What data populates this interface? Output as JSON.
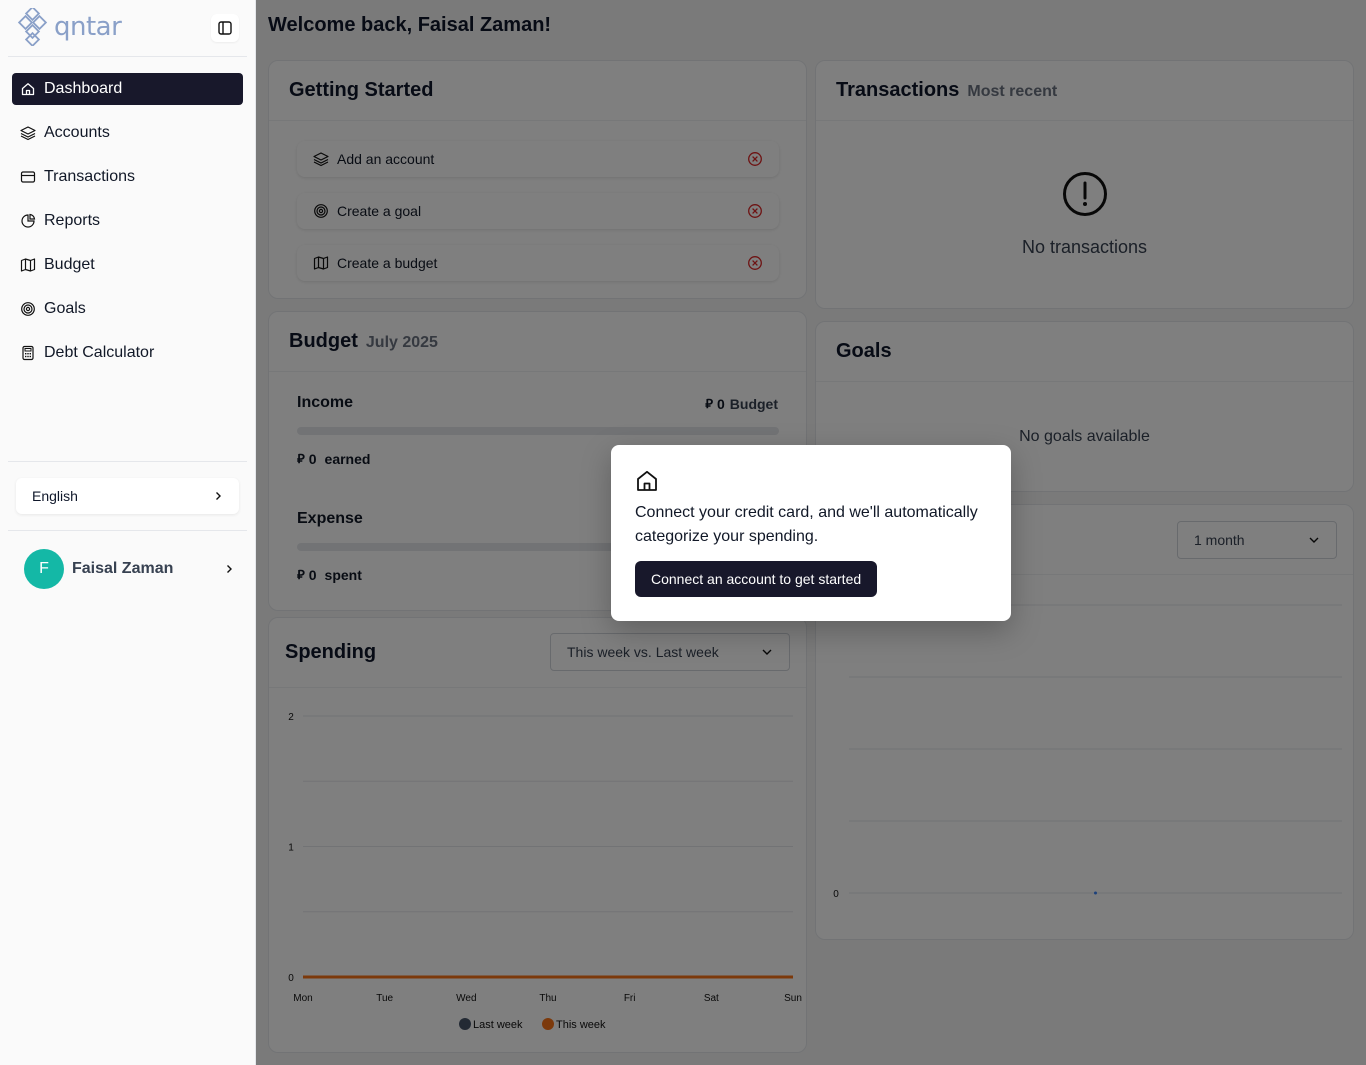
{
  "app": {
    "logo_text": "qntar"
  },
  "sidebar": {
    "items": [
      {
        "label": "Dashboard",
        "icon": "home-icon",
        "active": true
      },
      {
        "label": "Accounts",
        "icon": "layers-icon"
      },
      {
        "label": "Transactions",
        "icon": "credit-card-icon"
      },
      {
        "label": "Reports",
        "icon": "pie-chart-icon"
      },
      {
        "label": "Budget",
        "icon": "map-icon"
      },
      {
        "label": "Goals",
        "icon": "target-icon"
      },
      {
        "label": "Debt Calculator",
        "icon": "calculator-icon"
      }
    ],
    "language": "English",
    "user": {
      "initial": "F",
      "name": "Faisal Zaman"
    }
  },
  "main": {
    "welcome": "Welcome back, Faisal Zaman!",
    "getting_started": {
      "title": "Getting Started",
      "items": [
        {
          "label": "Add an account",
          "icon": "layers-icon"
        },
        {
          "label": "Create a goal",
          "icon": "target-icon"
        },
        {
          "label": "Create a budget",
          "icon": "map-icon"
        }
      ]
    },
    "transactions": {
      "title": "Transactions",
      "subtitle": "Most recent",
      "empty": "No transactions"
    },
    "budget": {
      "title": "Budget",
      "subtitle": "July 2025",
      "income_label": "Income",
      "income_budget_value": "0",
      "income_budget_label": "Budget",
      "earned_value": "0",
      "earned_label": "earned",
      "expense_label": "Expense",
      "spent_value": "0",
      "spent_label": "spent"
    },
    "goals": {
      "title": "Goals",
      "empty": "No goals available"
    },
    "net_worth": {
      "period": "1 month"
    },
    "spending": {
      "title": "Spending",
      "period": "This week vs. Last week"
    }
  },
  "modal": {
    "text": "Connect your credit card, and we'll automatically categorize your spending.",
    "button": "Connect an account to get started"
  },
  "colors": {
    "accent": "#18182b",
    "this_week": "#f97316",
    "last_week": "#475569",
    "avatar": "#14b8a6",
    "danger": "#dc2626"
  },
  "chart_data": [
    {
      "type": "line",
      "categories": [
        "Mon",
        "Tue",
        "Wed",
        "Thu",
        "Fri",
        "Sat",
        "Sun"
      ],
      "series": [
        {
          "name": "Last week",
          "values": [
            0,
            0,
            0,
            0,
            0,
            0,
            0
          ]
        },
        {
          "name": "This week",
          "values": [
            0,
            0,
            0,
            0,
            0,
            0,
            0
          ]
        }
      ],
      "yticks": [
        "0",
        "1",
        "2"
      ],
      "ylim": [
        0,
        2
      ],
      "legend": "bottom"
    },
    {
      "type": "line",
      "categories": [
        ""
      ],
      "series": [
        {
          "values": [
            0
          ]
        }
      ],
      "yticks": [
        "0",
        "1"
      ],
      "ylim": [
        0,
        1
      ]
    }
  ]
}
